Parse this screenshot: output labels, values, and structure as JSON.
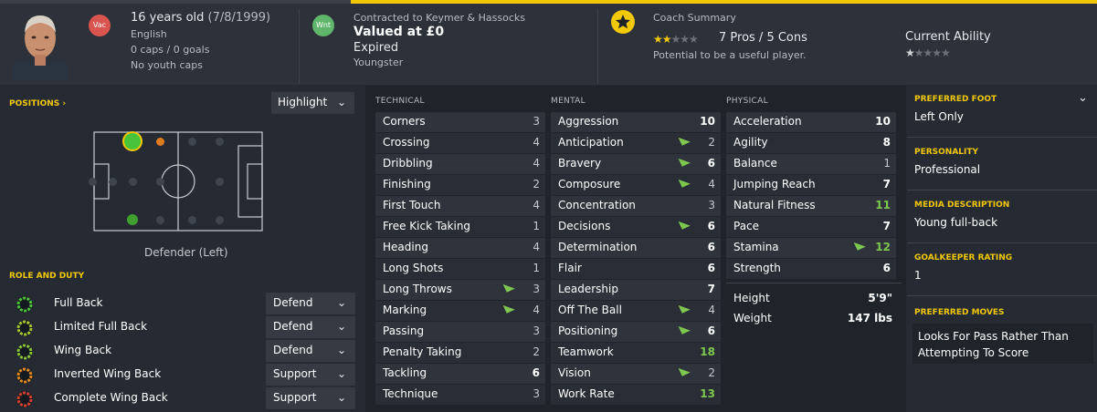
{
  "header": {
    "age": "16 years old",
    "dob": "(7/8/1999)",
    "nationality": "English",
    "caps": "0 caps / 0 goals",
    "youth_caps": "No youth caps",
    "nat_badge": "Vac",
    "contract_badge": "Wnt",
    "contract_to": "Contracted to Keymer & Hassocks",
    "value": "Valued at £0",
    "contract_status": "Expired",
    "squad_status": "Youngster",
    "coach_title": "Coach Summary",
    "pros_cons": "7 Pros / 5 Cons",
    "potential_text": "Potential to be a useful player.",
    "current_ability_label": "Current Ability",
    "coach_stars": 1.5,
    "ability_stars": 0.5
  },
  "positions": {
    "title": "POSITIONS",
    "title_arrow": "›",
    "highlight_label": "Highlight",
    "position_label": "Defender (Left)"
  },
  "roles": {
    "title": "ROLE AND DUTY",
    "items": [
      {
        "label": "Full Back",
        "duty": "Defend"
      },
      {
        "label": "Limited Full Back",
        "duty": "Defend"
      },
      {
        "label": "Wing Back",
        "duty": "Defend"
      },
      {
        "label": "Inverted Wing Back",
        "duty": "Support"
      },
      {
        "label": "Complete Wing Back",
        "duty": "Support"
      }
    ]
  },
  "technical": {
    "title": "TECHNICAL",
    "items": [
      {
        "name": "Corners",
        "value": "3"
      },
      {
        "name": "Crossing",
        "value": "4"
      },
      {
        "name": "Dribbling",
        "value": "4"
      },
      {
        "name": "Finishing",
        "value": "2"
      },
      {
        "name": "First Touch",
        "value": "4"
      },
      {
        "name": "Free Kick Taking",
        "value": "1"
      },
      {
        "name": "Heading",
        "value": "4"
      },
      {
        "name": "Long Shots",
        "value": "1"
      },
      {
        "name": "Long Throws",
        "value": "3"
      },
      {
        "name": "Marking",
        "value": "4"
      },
      {
        "name": "Passing",
        "value": "3"
      },
      {
        "name": "Penalty Taking",
        "value": "2"
      },
      {
        "name": "Tackling",
        "value": "6"
      },
      {
        "name": "Technique",
        "value": "3"
      }
    ]
  },
  "mental": {
    "title": "MENTAL",
    "items": [
      {
        "name": "Aggression",
        "value": "10"
      },
      {
        "name": "Anticipation",
        "value": "2"
      },
      {
        "name": "Bravery",
        "value": "6"
      },
      {
        "name": "Composure",
        "value": "4"
      },
      {
        "name": "Concentration",
        "value": "3"
      },
      {
        "name": "Decisions",
        "value": "6"
      },
      {
        "name": "Determination",
        "value": "6"
      },
      {
        "name": "Flair",
        "value": "6"
      },
      {
        "name": "Leadership",
        "value": "7"
      },
      {
        "name": "Off The Ball",
        "value": "4"
      },
      {
        "name": "Positioning",
        "value": "6"
      },
      {
        "name": "Teamwork",
        "value": "18"
      },
      {
        "name": "Vision",
        "value": "2"
      },
      {
        "name": "Work Rate",
        "value": "13"
      }
    ]
  },
  "physical": {
    "title": "PHYSICAL",
    "items": [
      {
        "name": "Acceleration",
        "value": "10"
      },
      {
        "name": "Agility",
        "value": "8"
      },
      {
        "name": "Balance",
        "value": "1"
      },
      {
        "name": "Jumping Reach",
        "value": "7"
      },
      {
        "name": "Natural Fitness",
        "value": "11"
      },
      {
        "name": "Pace",
        "value": "7"
      },
      {
        "name": "Stamina",
        "value": "12"
      },
      {
        "name": "Strength",
        "value": "6"
      }
    ],
    "height_label": "Height",
    "height_value": "5'9\"",
    "weight_label": "Weight",
    "weight_value": "147 lbs"
  },
  "info": {
    "preferred_foot_label": "PREFERRED FOOT",
    "preferred_foot": "Left Only",
    "personality_label": "PERSONALITY",
    "personality": "Professional",
    "media_label": "MEDIA DESCRIPTION",
    "media": "Young full-back",
    "gk_label": "GOALKEEPER RATING",
    "gk": "1",
    "moves_label": "PREFERRED MOVES",
    "moves": "Looks For Pass Rather Than Attempting To Score"
  },
  "colors": {
    "accent": "#f2c800",
    "green": "#7ec850",
    "nat_badge": "#d9534f",
    "contract_badge": "#5fb56a"
  }
}
